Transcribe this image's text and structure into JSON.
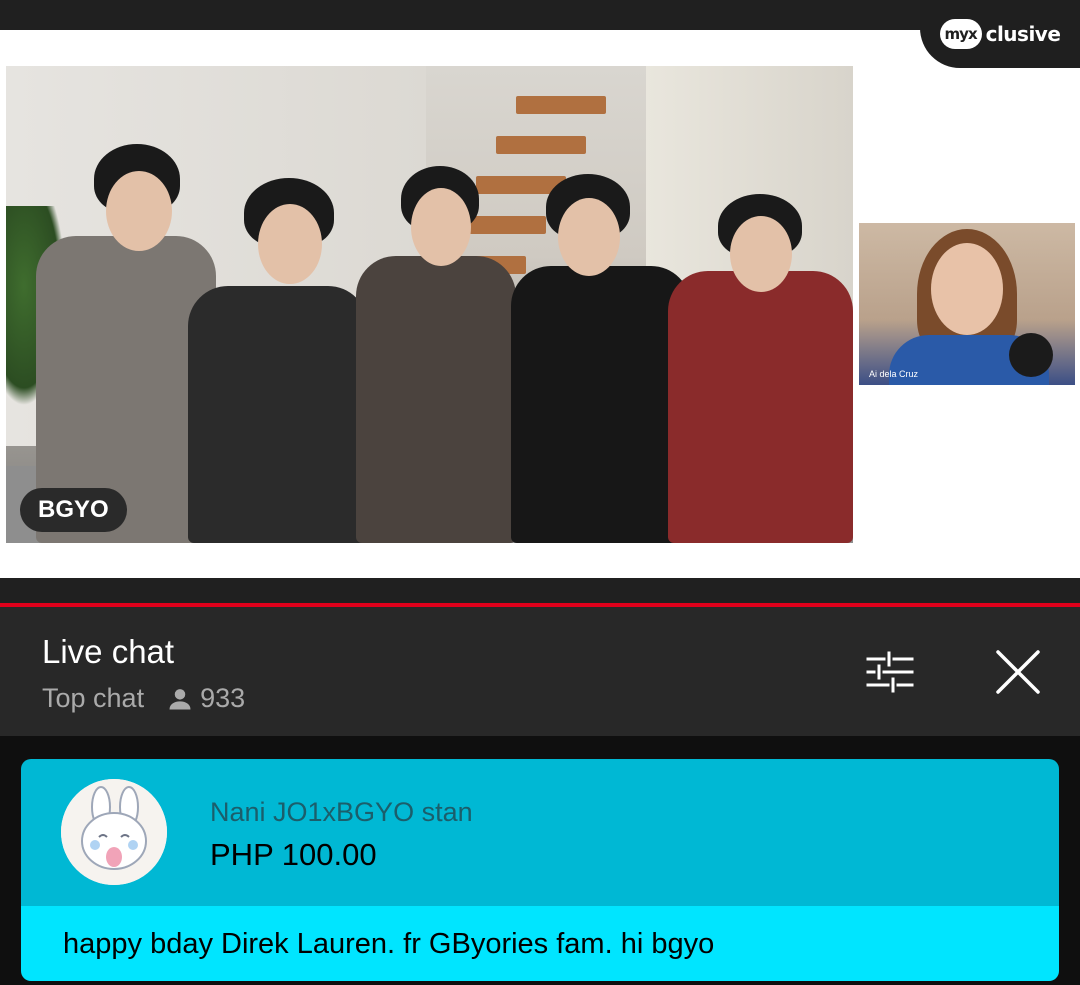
{
  "video": {
    "channel_logo": {
      "circle_text": "myx",
      "text": "clusive"
    },
    "main_feed_label": "BGYO",
    "side_feed_label": "Ai dela Cruz",
    "progress": {
      "color": "#e0001b",
      "fraction": 1.0
    }
  },
  "chat": {
    "title": "Live chat",
    "mode": "Top chat",
    "viewer_count": "933",
    "icons": {
      "viewers": "person-icon",
      "filter": "sliders-icon",
      "close": "close-icon"
    }
  },
  "superchat": {
    "author": "Nani JO1xBGYO stan",
    "amount": "PHP 100.00",
    "message": "happy bday Direk Lauren. fr GByories fam. hi bgyo",
    "colors": {
      "header": "#00b8d4",
      "body": "#00e5ff"
    }
  }
}
